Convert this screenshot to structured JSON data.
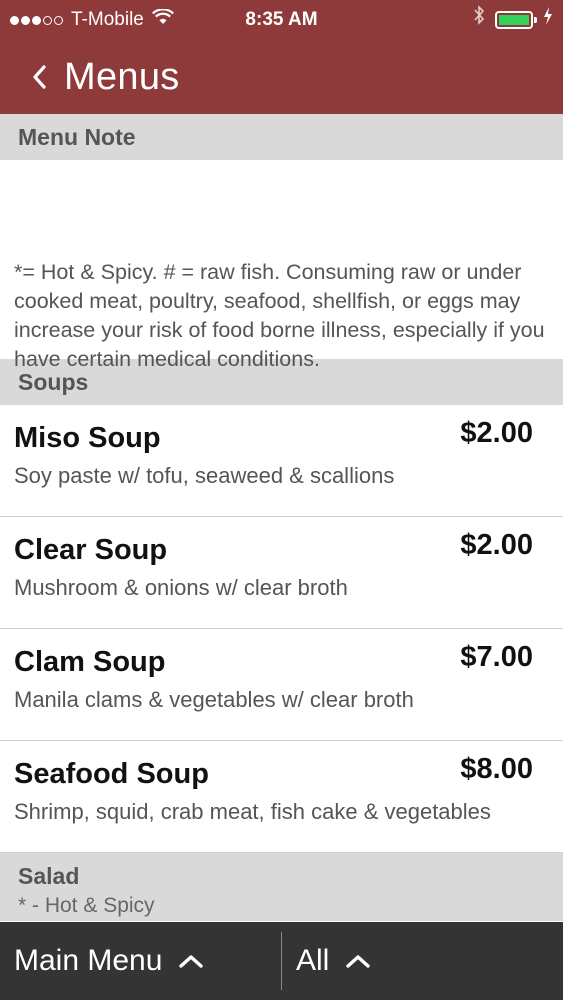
{
  "status_bar": {
    "carrier": "T-Mobile",
    "time": "8:35 AM",
    "signal_dots_filled": 3,
    "signal_dots_total": 5,
    "icons": [
      "wifi-icon",
      "bluetooth-icon",
      "battery-icon",
      "charging-bolt-icon"
    ],
    "battery_color": "#33d15c"
  },
  "nav": {
    "title": "Menus",
    "back_icon": "chevron-left-icon"
  },
  "sections": {
    "note": {
      "title": "Menu Note",
      "text": "*= Hot & Spicy. # = raw fish. Consuming raw or under cooked meat, poultry, seafood, shellfish, or eggs may increase your risk of food borne illness, especially if you have certain medical conditions."
    },
    "soups": {
      "title": "Soups",
      "items": [
        {
          "name": "Miso Soup",
          "price": "$2.00",
          "desc": "Soy paste w/ tofu, seaweed & scallions"
        },
        {
          "name": "Clear Soup",
          "price": "$2.00",
          "desc": "Mushroom & onions w/ clear broth"
        },
        {
          "name": "Clam Soup",
          "price": "$7.00",
          "desc": "Manila clams & vegetables w/ clear broth"
        },
        {
          "name": "Seafood Soup",
          "price": "$8.00",
          "desc": "Shrimp, squid, crab meat, fish cake & vegetables"
        }
      ]
    },
    "salad": {
      "title": "Salad",
      "subtitle": "* - Hot & Spicy"
    }
  },
  "toolbar": {
    "main_menu_label": "Main Menu",
    "all_label": "All",
    "caret_icon": "chevron-up-icon"
  },
  "colors": {
    "header_bg": "#8f3a3a",
    "section_bg": "#d9d9d9",
    "toolbar_bg": "#343434"
  }
}
